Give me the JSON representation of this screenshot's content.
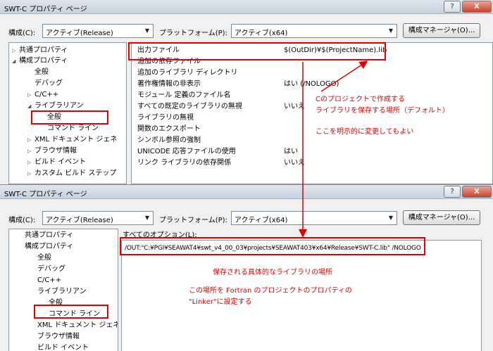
{
  "dialog1": {
    "title": "SWT-C プロパティ ページ",
    "help_glyph": "?",
    "close_glyph": "X",
    "config_label": "構成(C):",
    "config_value": "アクティブ(Release)",
    "platform_label": "プラットフォーム(P):",
    "platform_value": "アクティブ(x64)",
    "config_manager": "構成マネージャ(O)...",
    "tree": [
      "共通プロパティ",
      "構成プロパティ",
      "全般",
      "デバッグ",
      "C/C++",
      "ライブラリアン",
      "全般",
      "コマンド ライン",
      "XML ドキュメント ジェネ",
      "ブラウザ情報",
      "ビルド イベント",
      "カスタム ビルド ステップ"
    ],
    "props": [
      {
        "name": "出力ファイル",
        "value": "$(OutDir)¥$(ProjectName).lib"
      },
      {
        "name": "追加の依存ファイル",
        "value": ""
      },
      {
        "name": "追加のライブラリ ディレクトリ",
        "value": ""
      },
      {
        "name": "著作権情報の非表示",
        "value": "はい (/NOLOGO)"
      },
      {
        "name": "モジュール 定義のファイル名",
        "value": ""
      },
      {
        "name": "すべての既定のライブラリの無視",
        "value": "いいえ"
      },
      {
        "name": "ライブラリの無視",
        "value": ""
      },
      {
        "name": "関数のエクスポート",
        "value": ""
      },
      {
        "name": "シンボル参照の強制",
        "value": ""
      },
      {
        "name": "UNICODE 応答ファイルの使用",
        "value": "はい"
      },
      {
        "name": "リンク ライブラリの依存関係",
        "value": "いいえ"
      }
    ],
    "annotations": [
      "Cのプロジェクトで作成する",
      "ライブラリを保存する場所（デフォルト）",
      "ここを明示的に変更してもよい"
    ]
  },
  "dialog2": {
    "title": "SWT-C プロパティ ページ",
    "help_glyph": "?",
    "close_glyph": "X",
    "config_label": "構成(C):",
    "config_value": "アクティブ(Release)",
    "platform_label": "プラットフォーム(P):",
    "platform_value": "アクティブ(x64)",
    "config_manager": "構成マネージャ(O)...",
    "tree": [
      "共通プロパティ",
      "構成プロパティ",
      "全般",
      "デバッグ",
      "C/C++",
      "ライブラリアン",
      "全般",
      "コマンド ライン",
      "XML ドキュメント ジェネ",
      "ブラウザ情報",
      "ビルド イベント"
    ],
    "all_options_label": "すべてのオプション(L):",
    "options_text": "/OUT:\"C:¥PGI¥SEAWAT4¥swt_v4_00_03¥projects¥SEAWAT403¥x64¥Release¥SWT-C.lib\" /NOLOGO",
    "annotations": [
      "保存される具体的なライブラリの場所",
      "この場所を Fortran のプロジェクトのプロパティの",
      "\"Linker\"に設定する"
    ]
  },
  "colors": {
    "annotation": "#e00000",
    "title_bar": "#c7d2df",
    "window_bg": "#f0f0f0"
  }
}
